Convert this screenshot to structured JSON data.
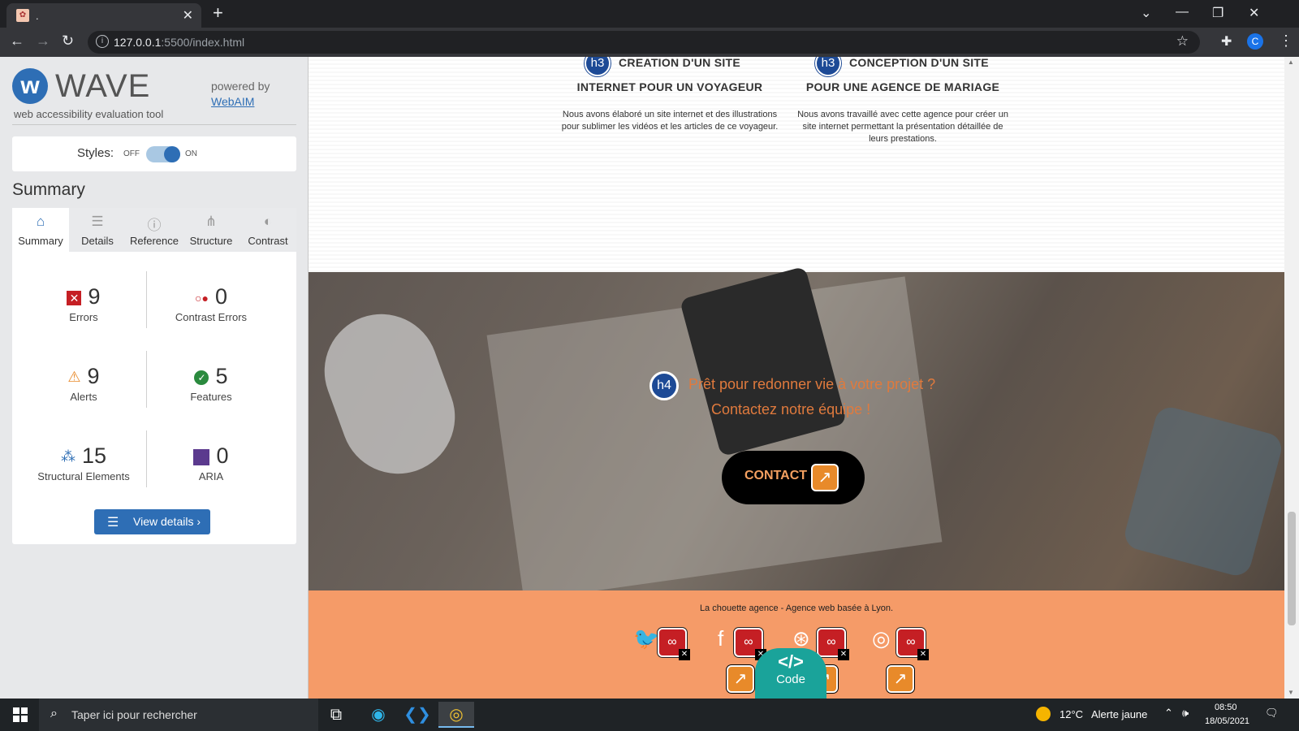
{
  "browser": {
    "tab_title": ".",
    "url_host": "127.0.0.1",
    "url_rest": ":5500/index.html",
    "profile_initial": "C"
  },
  "wave": {
    "title": "WAVE",
    "subtitle": "web accessibility evaluation tool",
    "powered_by": "powered by",
    "powered_link": "WebAIM",
    "styles_label": "Styles:",
    "styles_off": "OFF",
    "styles_on": "ON",
    "styles_enabled": true,
    "summary_heading": "Summary",
    "tabs": [
      {
        "label": "Summary",
        "icon": "home-icon",
        "active": true
      },
      {
        "label": "Details",
        "icon": "list-icon",
        "active": false
      },
      {
        "label": "Reference",
        "icon": "info-icon",
        "active": false
      },
      {
        "label": "Structure",
        "icon": "hierarchy-icon",
        "active": false
      },
      {
        "label": "Contrast",
        "icon": "contrast-icon",
        "active": false
      }
    ],
    "stats": {
      "errors": {
        "count": "9",
        "label": "Errors"
      },
      "contrast_errors": {
        "count": "0",
        "label": "Contrast Errors"
      },
      "alerts": {
        "count": "9",
        "label": "Alerts"
      },
      "features": {
        "count": "5",
        "label": "Features"
      },
      "structural": {
        "count": "15",
        "label": "Structural Elements"
      },
      "aria": {
        "count": "0",
        "label": "ARIA"
      }
    },
    "view_details": "View details ›"
  },
  "page": {
    "cards": [
      {
        "badge": "h3",
        "title_line1": "CREATION D'UN SITE",
        "title_line2": "INTERNET POUR UN VOYAGEUR",
        "text_line1": "Nous avons élaboré un site internet et des illustrations",
        "text_line2": "pour sublimer les vidéos et les articles de ce voyageur."
      },
      {
        "badge": "h3",
        "title_line1": "CONCEPTION D'UN SITE",
        "title_line2": "POUR UNE AGENCE DE MARIAGE",
        "text_line1": "Nous avons travaillé avec cette agence pour créer un",
        "text_line2": "site internet permettant la présentation détaillée de",
        "text_line3": "leurs prestations."
      }
    ],
    "hero_badge": "h4",
    "hero_line1": "Prêt pour redonner vie à votre projet ?",
    "hero_line2": "Contactez notre équipe !",
    "contact_label": "CONTACT",
    "footer_text": "La chouette agence - Agence web basée à Lyon.",
    "code_label": "Code"
  },
  "taskbar": {
    "search_placeholder": "Taper ici pour rechercher",
    "temperature": "12°C",
    "weather_alert": "Alerte jaune",
    "time": "08:50",
    "date": "18/05/2021"
  },
  "colors": {
    "wave_blue": "#2e6eb5",
    "error_red": "#c51f24",
    "alert_orange": "#e88a2a",
    "footer_orange": "#f59b68",
    "hero_text": "#e07a3d",
    "code_teal": "#1aa39a"
  }
}
